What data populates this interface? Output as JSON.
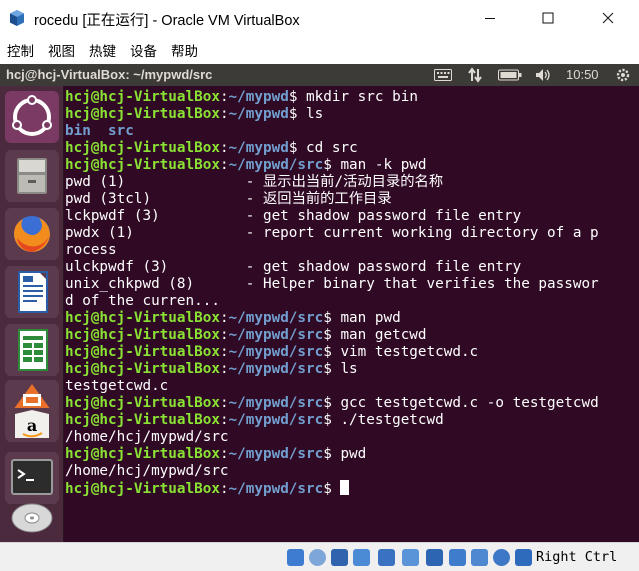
{
  "window": {
    "title": "rocedu [正在运行] - Oracle VM VirtualBox",
    "controls": {
      "minimize": "—",
      "maximize": "☐",
      "close": "✕"
    }
  },
  "menu": [
    "控制",
    "视图",
    "热键",
    "设备",
    "帮助"
  ],
  "panel": {
    "title": "hcj@hcj-VirtualBox: ~/mypwd/src",
    "clock": "10:50",
    "icons": [
      "keyboard-icon",
      "network-arrows-icon",
      "battery-icon",
      "volume-icon",
      "power-gear-icon"
    ]
  },
  "launcher": {
    "items": [
      "ubuntu-dash-icon",
      "files-icon",
      "firefox-icon",
      "writer-icon",
      "calc-icon",
      "impress-icon",
      "amazon-icon",
      "terminal-icon",
      "dvd-icon"
    ]
  },
  "terminal": {
    "prompt_user": "hcj@hcj-VirtualBox",
    "lines": [
      {
        "type": "prompt",
        "path": "~/mypwd",
        "cmd": " mkdir src bin"
      },
      {
        "type": "prompt",
        "path": "~/mypwd",
        "cmd": " ls"
      },
      {
        "type": "dirs",
        "text": "bin  src"
      },
      {
        "type": "prompt",
        "path": "~/mypwd",
        "cmd": " cd src"
      },
      {
        "type": "prompt",
        "path": "~/mypwd/src",
        "cmd": " man -k pwd"
      },
      {
        "type": "out",
        "text": "pwd (1)              - 显示出当前/活动目录的名称"
      },
      {
        "type": "out",
        "text": "pwd (3tcl)           - 返回当前的工作目录"
      },
      {
        "type": "out",
        "text": "lckpwdf (3)          - get shadow password file entry"
      },
      {
        "type": "out",
        "text": "pwdx (1)             - report current working directory of a p"
      },
      {
        "type": "out",
        "text": "rocess"
      },
      {
        "type": "out",
        "text": "ulckpwdf (3)         - get shadow password file entry"
      },
      {
        "type": "out",
        "text": "unix_chkpwd (8)      - Helper binary that verifies the passwor"
      },
      {
        "type": "out",
        "text": "d of the curren..."
      },
      {
        "type": "prompt",
        "path": "~/mypwd/src",
        "cmd": " man pwd"
      },
      {
        "type": "prompt",
        "path": "~/mypwd/src",
        "cmd": " man getcwd"
      },
      {
        "type": "prompt",
        "path": "~/mypwd/src",
        "cmd": " vim testgetcwd.c"
      },
      {
        "type": "prompt",
        "path": "~/mypwd/src",
        "cmd": " ls"
      },
      {
        "type": "out",
        "text": "testgetcwd.c"
      },
      {
        "type": "prompt",
        "path": "~/mypwd/src",
        "cmd": " gcc testgetcwd.c -o testgetcwd"
      },
      {
        "type": "prompt",
        "path": "~/mypwd/src",
        "cmd": " ./testgetcwd"
      },
      {
        "type": "out",
        "text": "/home/hcj/mypwd/src"
      },
      {
        "type": "prompt",
        "path": "~/mypwd/src",
        "cmd": " pwd"
      },
      {
        "type": "out",
        "text": "/home/hcj/mypwd/src"
      },
      {
        "type": "prompt",
        "path": "~/mypwd/src",
        "cmd": " ",
        "cursor": true
      }
    ]
  },
  "statusbar": {
    "icons": [
      "hard-disk-icon",
      "optical-drive-icon",
      "audio-icon",
      "network-icon",
      "usb-icon",
      "shared-folders-icon",
      "display-icon",
      "video-capture-icon",
      "cpu-icon",
      "mouse-integration-icon",
      "arrow-down-icon"
    ],
    "host_key": "Right Ctrl"
  },
  "colors": {
    "terminal_bg": "#300a24",
    "prompt_user": "#8ae234",
    "prompt_path": "#729fcf",
    "launcher_bg": "#4c2a3e",
    "panel_bg": "#3c3b37"
  }
}
